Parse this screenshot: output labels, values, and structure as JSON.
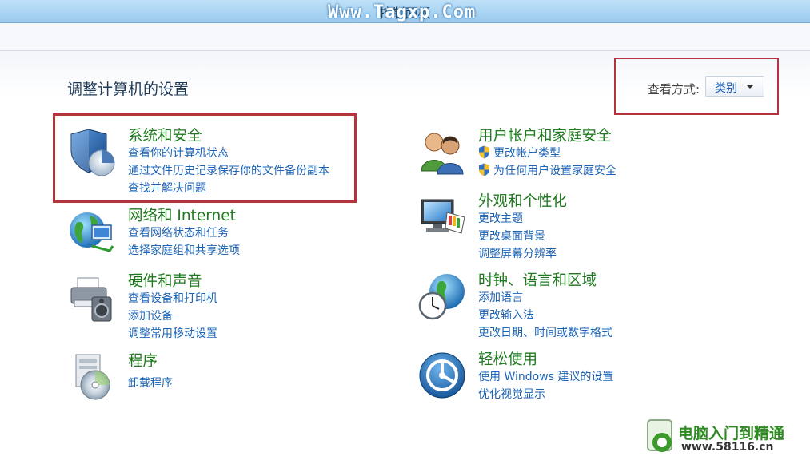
{
  "window": {
    "title": "控制面板",
    "watermark": "Www.Tagxp.Com"
  },
  "main": {
    "heading": "调整计算机的设置",
    "view_by": {
      "label": "查看方式:",
      "selected": "类别"
    }
  },
  "categories": [
    {
      "title": "系统和安全",
      "icon": "system-security-shield-icon",
      "links": [
        "查看你的计算机状态",
        "通过文件历史记录保存你的文件备份副本",
        "查找并解决问题"
      ]
    },
    {
      "title": "网络和 Internet",
      "icon": "network-globe-icon",
      "links": [
        "查看网络状态和任务",
        "选择家庭组和共享选项"
      ]
    },
    {
      "title": "硬件和声音",
      "icon": "printer-speaker-icon",
      "links": [
        "查看设备和打印机",
        "添加设备",
        "调整常用移动设置"
      ]
    },
    {
      "title": "程序",
      "icon": "programs-disc-icon",
      "links": [
        "卸载程序"
      ]
    },
    {
      "title": "用户帐户和家庭安全",
      "icon": "users-icon",
      "links": [
        "更改帐户类型",
        "为任何用户设置家庭安全"
      ]
    },
    {
      "title": "外观和个性化",
      "icon": "monitor-palette-icon",
      "links": [
        "更改主题",
        "更改桌面背景",
        "调整屏幕分辨率"
      ]
    },
    {
      "title": "时钟、语言和区域",
      "icon": "clock-globe-icon",
      "links": [
        "添加语言",
        "更改输入法",
        "更改日期、时间或数字格式"
      ]
    },
    {
      "title": "轻松使用",
      "icon": "ease-of-access-icon",
      "links": [
        "使用 Windows 建议的设置",
        "优化视觉显示"
      ]
    }
  ],
  "brand": {
    "name": "电脑入门到精通",
    "url": "www.58116.cn"
  }
}
